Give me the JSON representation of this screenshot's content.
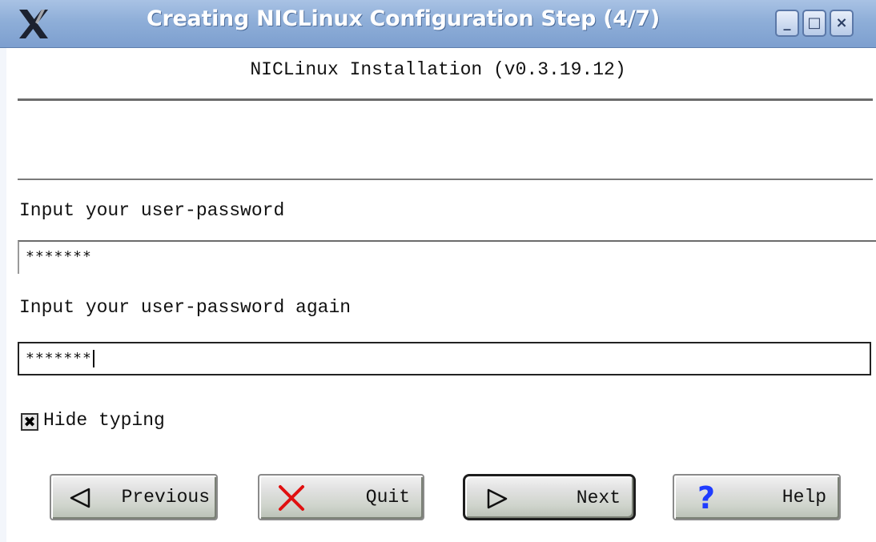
{
  "window": {
    "title": "Creating NICLinux Configuration Step (4/7)",
    "controls": {
      "minimize": "_",
      "maximize": "□",
      "close": "×"
    }
  },
  "header": {
    "text": "NICLinux Installation (v0.3.19.12)"
  },
  "form": {
    "password_label": "Input your user-password",
    "password_value": "*******",
    "password_again_label": "Input your user-password again",
    "password_again_value": "*******",
    "hide_typing_label": "Hide typing",
    "hide_typing_checked": true
  },
  "buttons": {
    "previous": "Previous",
    "quit": "Quit",
    "next": "Next",
    "help": "Help"
  },
  "icons": {
    "window_logo": "x-logo-icon",
    "previous": "left-triangle-icon",
    "quit": "red-x-icon",
    "next": "right-triangle-icon",
    "help": "question-mark-icon"
  },
  "colors": {
    "titlebar": "#8eaed8",
    "quit_icon": "#e01010",
    "help_icon": "#1f3cff"
  }
}
